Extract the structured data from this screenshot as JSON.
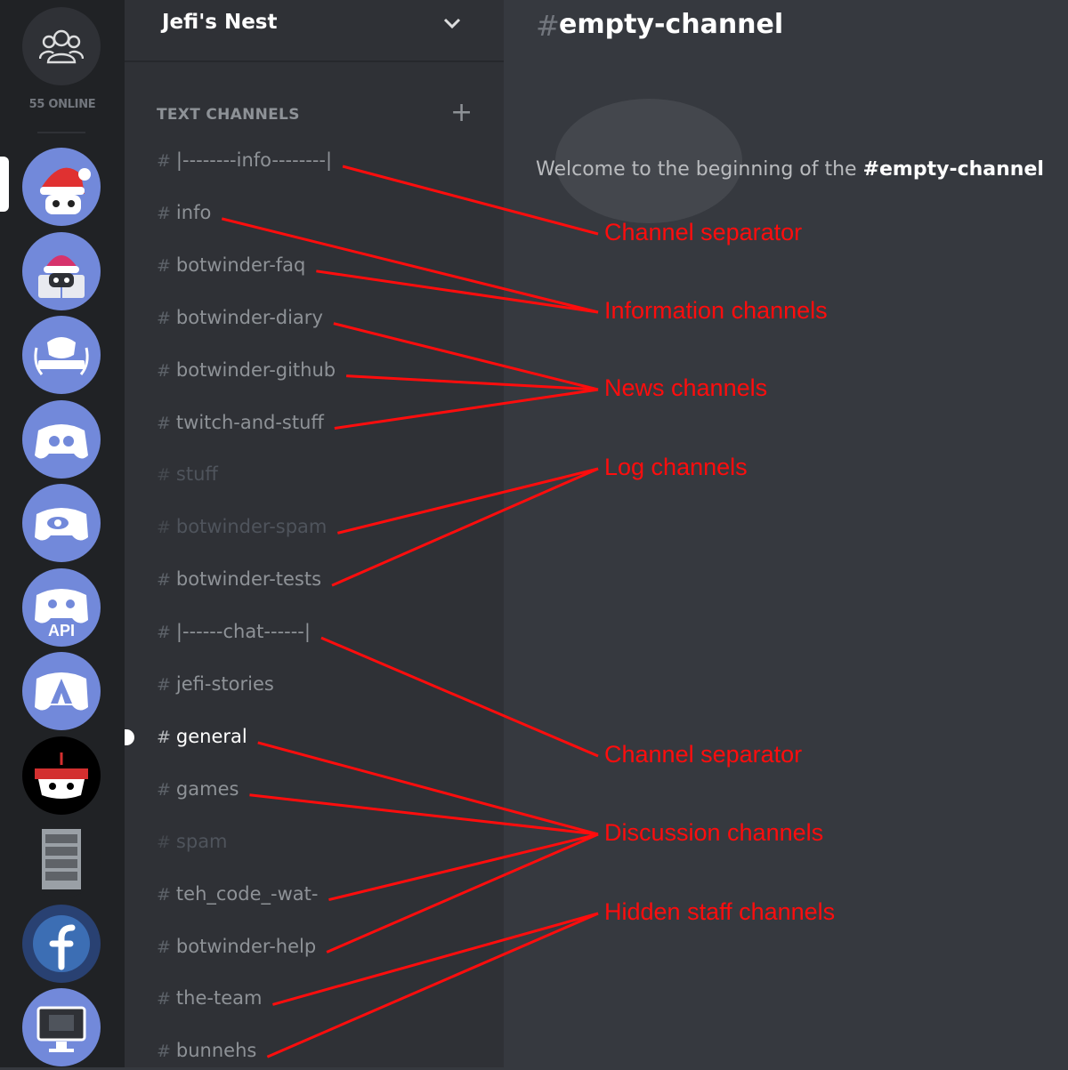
{
  "rail": {
    "online_label": "55 ONLINE",
    "servers": [
      {
        "icon": "santa-bot-icon",
        "color": "#7289da",
        "label": ""
      },
      {
        "icon": "santa-book-bot-icon",
        "color": "#7289da",
        "label": ""
      },
      {
        "icon": "partner-badge-icon",
        "color": "#7289da",
        "label": ""
      },
      {
        "icon": "gears-controller-icon",
        "color": "#7289da",
        "label": ""
      },
      {
        "icon": "discord-eye-icon",
        "color": "#7289da",
        "label": ""
      },
      {
        "icon": "discord-api-icon",
        "color": "#7289da",
        "label": "API"
      },
      {
        "icon": "discord-linux-icon",
        "color": "#7289da",
        "label": ""
      },
      {
        "icon": "ninja-controller-icon",
        "color": "#000000",
        "label": ""
      },
      {
        "icon": "server-rack-icon",
        "color": "#202225",
        "label": ""
      },
      {
        "icon": "fedora-icon",
        "color": "#294172",
        "label": ""
      },
      {
        "icon": "monitor-icon",
        "color": "#7289da",
        "label": ""
      }
    ]
  },
  "sidebar": {
    "server_name": "Jefi's Nest",
    "category": "TEXT CHANNELS",
    "channels": [
      {
        "name": "|--------info--------|",
        "state": "normal"
      },
      {
        "name": "info",
        "state": "normal"
      },
      {
        "name": "botwinder-faq",
        "state": "normal"
      },
      {
        "name": "botwinder-diary",
        "state": "normal"
      },
      {
        "name": "botwinder-github",
        "state": "normal"
      },
      {
        "name": "twitch-and-stuff",
        "state": "normal"
      },
      {
        "name": "stuff",
        "state": "muted"
      },
      {
        "name": "botwinder-spam",
        "state": "muted"
      },
      {
        "name": "botwinder-tests",
        "state": "normal"
      },
      {
        "name": "|------chat------|",
        "state": "normal"
      },
      {
        "name": "jefi-stories",
        "state": "normal"
      },
      {
        "name": "general",
        "state": "unread"
      },
      {
        "name": "games",
        "state": "normal"
      },
      {
        "name": "spam",
        "state": "muted"
      },
      {
        "name": "teh_code_-wat-",
        "state": "normal"
      },
      {
        "name": "botwinder-help",
        "state": "normal"
      },
      {
        "name": "the-team",
        "state": "normal"
      },
      {
        "name": "bunnehs",
        "state": "normal"
      }
    ]
  },
  "main": {
    "hash": "#",
    "channel_title": "empty-channel",
    "welcome_prefix": "Welcome to the beginning of the ",
    "welcome_channel": "#empty-channel"
  },
  "annotations": [
    {
      "text": "Channel separator",
      "targets": [
        0
      ]
    },
    {
      "text": "Information channels",
      "targets": [
        1,
        2
      ]
    },
    {
      "text": "News channels",
      "targets": [
        3,
        4,
        5
      ]
    },
    {
      "text": "Log channels",
      "targets": [
        7,
        8
      ]
    },
    {
      "text": "Channel separator",
      "targets": [
        9
      ]
    },
    {
      "text": "Discussion channels",
      "targets": [
        11,
        12,
        14,
        15
      ]
    },
    {
      "text": "Hidden staff channels",
      "targets": [
        16,
        17
      ]
    }
  ],
  "colors": {
    "channel_normal": "#8e9297",
    "channel_muted": "#4f545c",
    "channel_unread": "#ffffff",
    "annotation": "#ff0d0d",
    "blurple": "#7289da"
  }
}
